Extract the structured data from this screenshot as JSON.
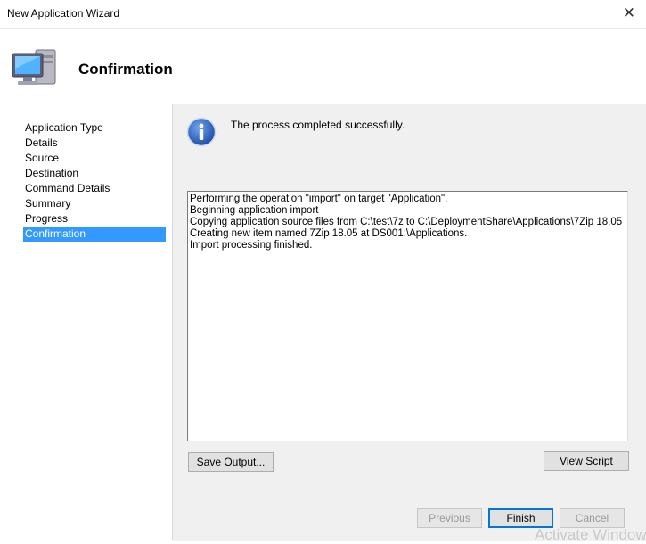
{
  "window": {
    "title": "New Application Wizard",
    "close_glyph": "✕"
  },
  "header": {
    "title": "Confirmation",
    "icon": "computer-icon"
  },
  "nav": {
    "items": [
      {
        "label": "Application Type"
      },
      {
        "label": "Details"
      },
      {
        "label": "Source"
      },
      {
        "label": "Destination"
      },
      {
        "label": "Command Details"
      },
      {
        "label": "Summary"
      },
      {
        "label": "Progress"
      },
      {
        "label": "Confirmation",
        "active": true
      }
    ]
  },
  "main": {
    "status_icon": "info-icon",
    "status_text": "The process completed successfully.",
    "output_lines": [
      "Performing the operation \"import\" on target \"Application\".",
      "Beginning application import",
      "Copying application source files from C:\\test\\7z to C:\\DeploymentShare\\Applications\\7Zip 18.05",
      "Creating new item named 7Zip 18.05 at DS001:\\Applications.",
      "Import processing finished."
    ],
    "save_output_label": "Save Output...",
    "view_script_label": "View Script"
  },
  "footer": {
    "previous_label": "Previous",
    "finish_label": "Finish",
    "cancel_label": "Cancel"
  },
  "watermark": {
    "text": "Activate Windows"
  },
  "colors": {
    "selection": "#3399ff",
    "default_button_border": "#0078d7",
    "info_icon": "#1f5ab5"
  }
}
